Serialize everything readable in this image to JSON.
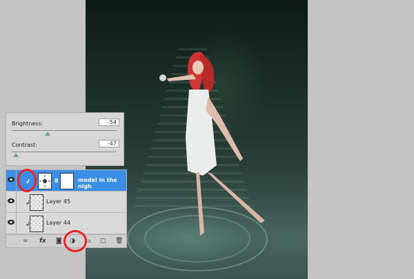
{
  "adjustment": {
    "brightness_label": "Brightness:",
    "brightness_value": "-54",
    "contrast_label": "Contrast:",
    "contrast_value": "-47"
  },
  "layers": [
    {
      "name": "model in the nigh",
      "selected": true
    },
    {
      "name": "Layer 45",
      "selected": false
    },
    {
      "name": "Layer 44",
      "selected": false
    }
  ],
  "bottom_bar": {
    "link_icon": "link-icon",
    "fx_label": "fx",
    "mask_icon": "mask-icon",
    "adjustment_icon": "adjustment-layer-icon",
    "group_icon": "folder-icon",
    "new_layer_icon": "new-layer-icon",
    "delete_icon": "trash-icon"
  },
  "colors": {
    "selection": "#3a8ee6",
    "highlight_circle": "#e22222"
  }
}
